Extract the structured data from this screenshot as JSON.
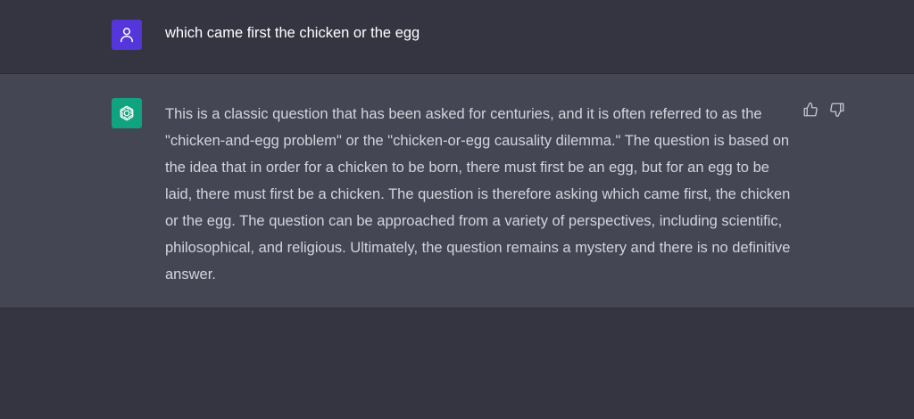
{
  "colors": {
    "user_avatar_bg": "#5436da",
    "assistant_avatar_bg": "#10a37f",
    "user_row_bg": "#343541",
    "assistant_row_bg": "#444654"
  },
  "user_message": {
    "avatar_icon": "user-icon",
    "text": "which came first the chicken or the egg"
  },
  "assistant_message": {
    "avatar_icon": "openai-logo-icon",
    "text": "This is a classic question that has been asked for centuries, and it is often referred to as the \"chicken-and-egg problem\" or the \"chicken-or-egg causality dilemma.\" The question is based on the idea that in order for a chicken to be born, there must first be an egg, but for an egg to be laid, there must first be a chicken. The question is therefore asking which came first, the chicken or the egg. The question can be approached from a variety of perspectives, including scientific, philosophical, and religious. Ultimately, the question remains a mystery and there is no definitive answer.",
    "feedback": {
      "thumbs_up_icon": "thumbs-up-icon",
      "thumbs_down_icon": "thumbs-down-icon"
    }
  }
}
